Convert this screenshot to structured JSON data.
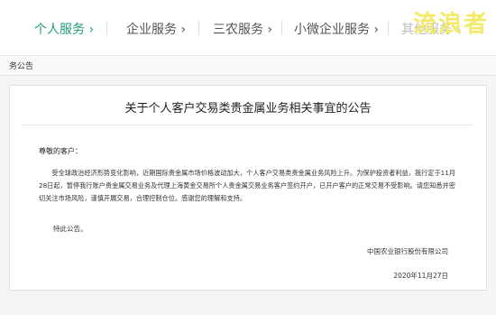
{
  "nav": {
    "items": [
      {
        "label": "个人服务 ›",
        "active": true
      },
      {
        "label": "企业服务 ›",
        "active": false
      },
      {
        "label": "三农服务 ›",
        "active": false
      },
      {
        "label": "小微企业服务 ›",
        "active": false
      },
      {
        "label": "其他服务 ›",
        "active": false
      }
    ],
    "watermark": "流浪者"
  },
  "breadcrumb": "务公告",
  "notice": {
    "title": "关于个人客户交易类贵金属业务相关事宜的公告",
    "greeting": "尊敬的客户：",
    "body": "受全球政治经济形势变化影响，近期国际贵金属市场价格波动加大，个人客户交易类贵金属业务风险上升。为保护投资者利益，我行定于11月28日起，暂停我行账户贵金属交易业务及代理上海黄金交易所个人贵金属交易业务客户签约开户，已开户客户的正常交易不受影响。请您知悉并密切关注市场风险，谨慎开展交易，合理控制仓位。感谢您的理解和支持。",
    "closing": "特此公告。",
    "signature": "中国农业银行股份有限公司",
    "date": "2020年11月27日"
  },
  "colors": {
    "accent": "#1f9d7a",
    "watermark": "#f4ea6a"
  }
}
